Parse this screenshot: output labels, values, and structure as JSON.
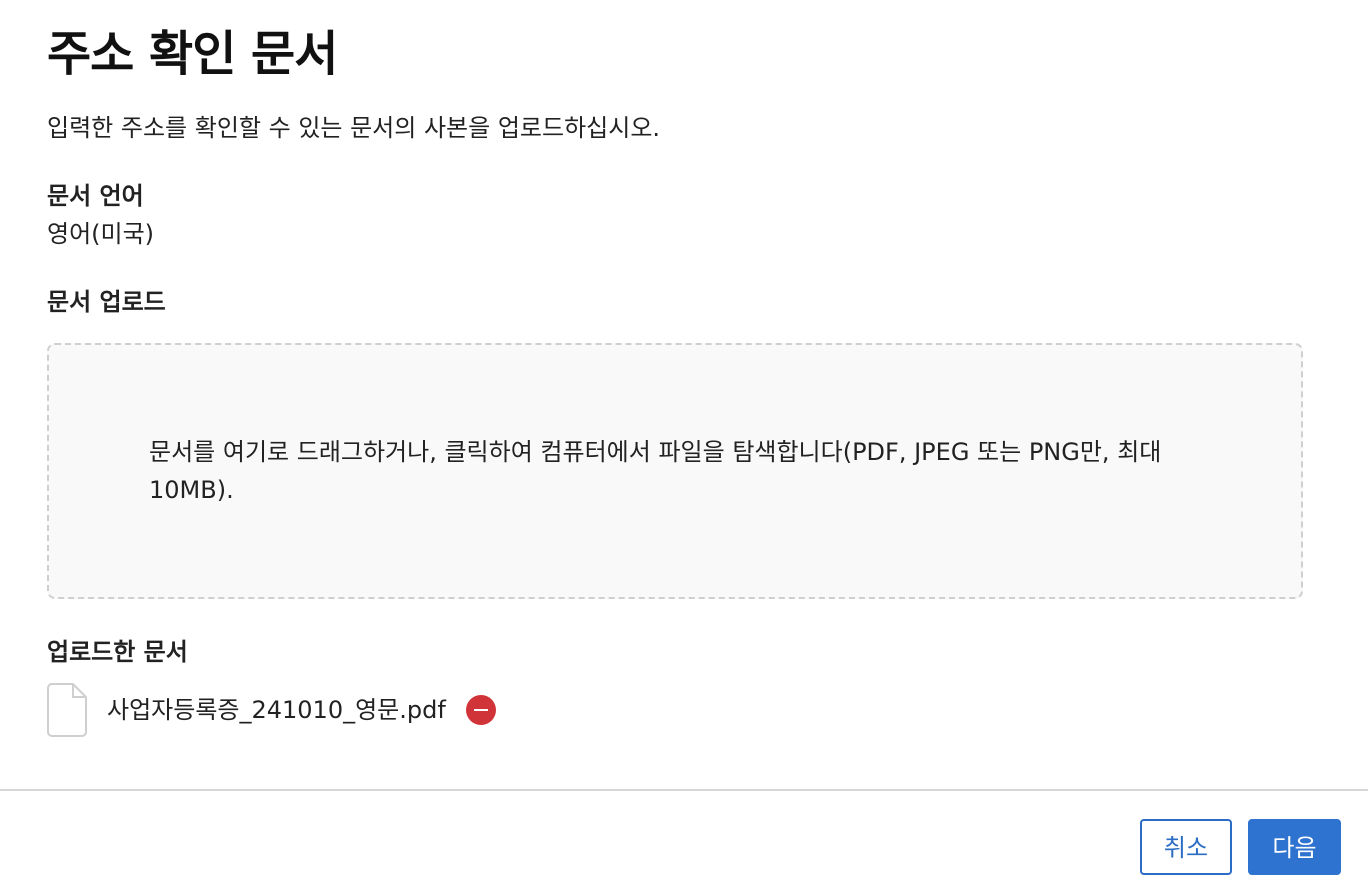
{
  "page": {
    "title": "주소 확인 문서",
    "subtitle": "입력한 주소를 확인할 수 있는 문서의 사본을 업로드하십시오."
  },
  "document_language": {
    "label": "문서 언어",
    "value": "영어(미국)"
  },
  "upload": {
    "label": "문서 업로드",
    "dropzone_text": "문서를 여기로 드래그하거나, 클릭하여 컴퓨터에서 파일을 탐색합니다(PDF, JPEG 또는 PNG만, 최대 10MB)."
  },
  "uploaded_documents": {
    "label": "업로드한 문서",
    "files": [
      {
        "name": "사업자등록증_241010_영문.pdf",
        "icon": "file-icon",
        "remove_icon": "remove-circle-icon"
      }
    ]
  },
  "footer": {
    "cancel_label": "취소",
    "next_label": "다음"
  },
  "colors": {
    "primary": "#2f73d0",
    "remove": "#d13438",
    "dropzone_bg": "#f9f9f9",
    "dropzone_border": "#cfcfcf"
  }
}
